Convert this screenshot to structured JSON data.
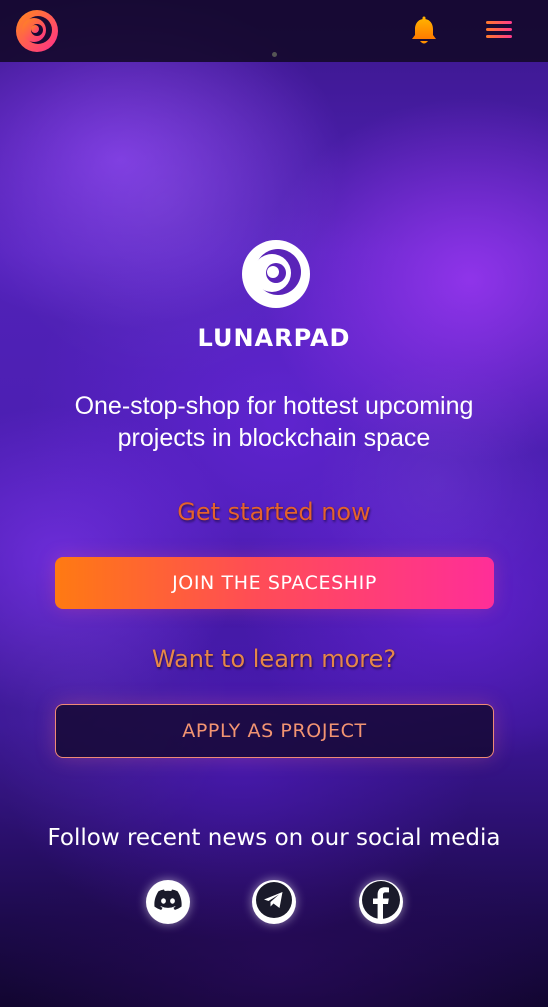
{
  "nav": {
    "logo_icon": "lunarpad-logo-icon",
    "bell_icon": "bell-icon",
    "menu_icon": "hamburger-menu-icon",
    "accent_gradient": [
      "#ff7a12",
      "#ff2e98"
    ]
  },
  "hero": {
    "brand_name": "LUNARPAD",
    "tagline": "One-stop-shop for hottest upcoming projects in blockchain space"
  },
  "cta": {
    "get_started_heading": "Get started now",
    "join_button_label": "JOIN THE SPACESHIP",
    "learn_more_heading": "Want to learn more?",
    "apply_button_label": "APPLY AS PROJECT"
  },
  "social": {
    "heading": "Follow recent news on our social media",
    "links": [
      {
        "name": "discord",
        "icon": "discord-icon"
      },
      {
        "name": "telegram",
        "icon": "telegram-icon"
      },
      {
        "name": "facebook",
        "icon": "facebook-icon"
      }
    ]
  },
  "colors": {
    "primary_orange": "#ff7a12",
    "primary_pink": "#ff2e98",
    "outline": "#f08a76",
    "bg_purple": "#4a1db0"
  }
}
